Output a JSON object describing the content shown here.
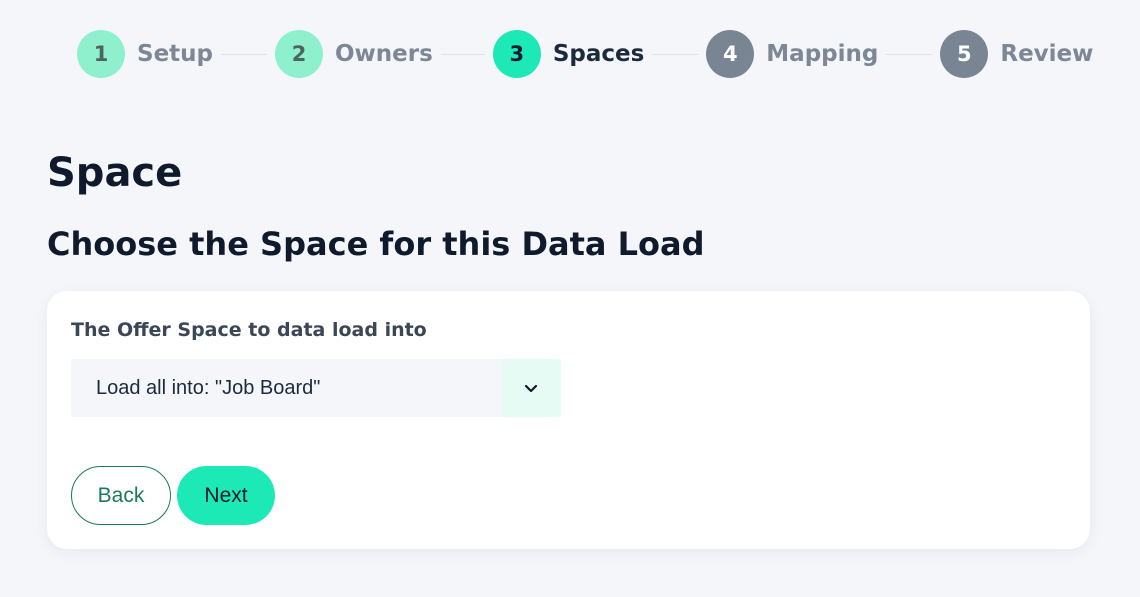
{
  "stepper": {
    "steps": [
      {
        "number": "1",
        "label": "Setup",
        "state": "done"
      },
      {
        "number": "2",
        "label": "Owners",
        "state": "done"
      },
      {
        "number": "3",
        "label": "Spaces",
        "state": "active"
      },
      {
        "number": "4",
        "label": "Mapping",
        "state": "todo"
      },
      {
        "number": "5",
        "label": "Review",
        "state": "todo"
      }
    ]
  },
  "page": {
    "title": "Space",
    "subtitle": "Choose the Space for this Data Load"
  },
  "form": {
    "space_label": "The Offer Space to data load into",
    "space_select": {
      "value": "Load all into: \"Job Board\"",
      "icon": "chevron-down-icon"
    },
    "back_label": "Back",
    "next_label": "Next"
  },
  "colors": {
    "accent": "#1de9b6",
    "done_step": "#8ef0cd",
    "todo_step": "#7a8594",
    "back_button_border": "#1a7a5a",
    "background": "#f4f6fa"
  }
}
